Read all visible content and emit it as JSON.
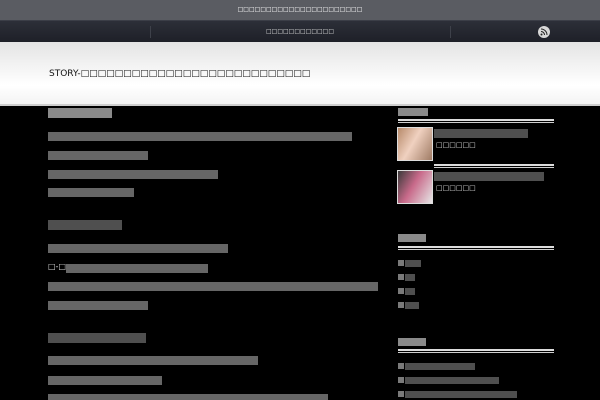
{
  "topbar": {
    "text": "□□□□□□□□□□□□□□□□□□□□□□"
  },
  "nav": {
    "menu_label": "□□□□□□□□□□□□"
  },
  "header": {
    "site_title": "STORY-□□□□□□□□□□□□□□□□□□□□□□□□□□□"
  },
  "content": {
    "line_fragment": "□-□",
    "comma_fragment": "□□□□□□□□□□□。"
  },
  "sidebar": {
    "post1_sub": "□□□□□□",
    "post2_sub": "□□□□□□"
  },
  "icons": [
    "rss-icon"
  ],
  "colors": {
    "topbar": "#5a5c62",
    "navbar": "#22252d",
    "header": "#f2f2f2",
    "body": "#000000"
  }
}
